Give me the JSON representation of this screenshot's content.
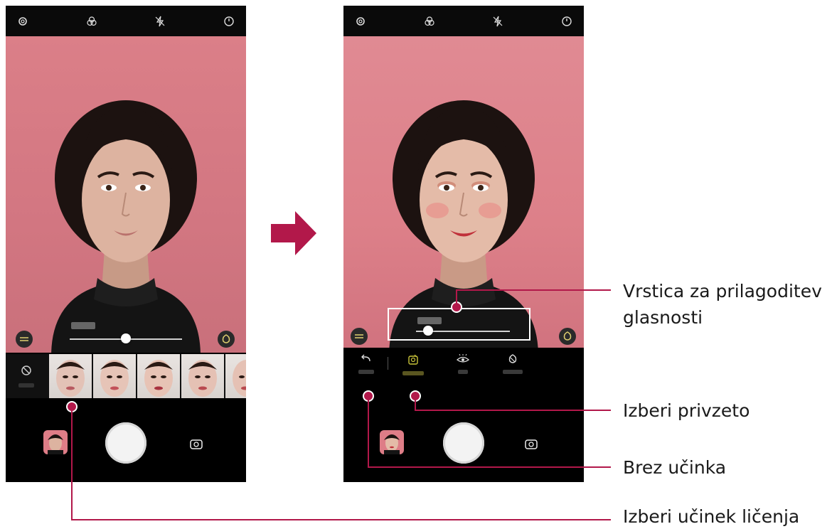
{
  "callouts": {
    "volume_bar_line1": "Vrstica za prilagoditev",
    "volume_bar_line2": "glasnosti",
    "choose_attachment": "Izberi privzeto",
    "no_effect": "Brez učinka",
    "choose_makeup_effect": "Izberi učinek ličenja"
  },
  "colors": {
    "accent": "#b2184a",
    "highlight_yellow": "#c9c43a"
  },
  "status_icons": [
    "gear-icon",
    "filter-icon",
    "flash-off-icon",
    "timer-icon"
  ],
  "left_phone": {
    "effects_count_visible": 5,
    "slider_level": 0.5
  },
  "right_phone": {
    "tabs": [
      "undo-icon",
      "makeup-face-icon",
      "eye-icon",
      "contour-icon"
    ],
    "selected_tab": "makeup-face-icon",
    "slider_level": 0.1
  }
}
